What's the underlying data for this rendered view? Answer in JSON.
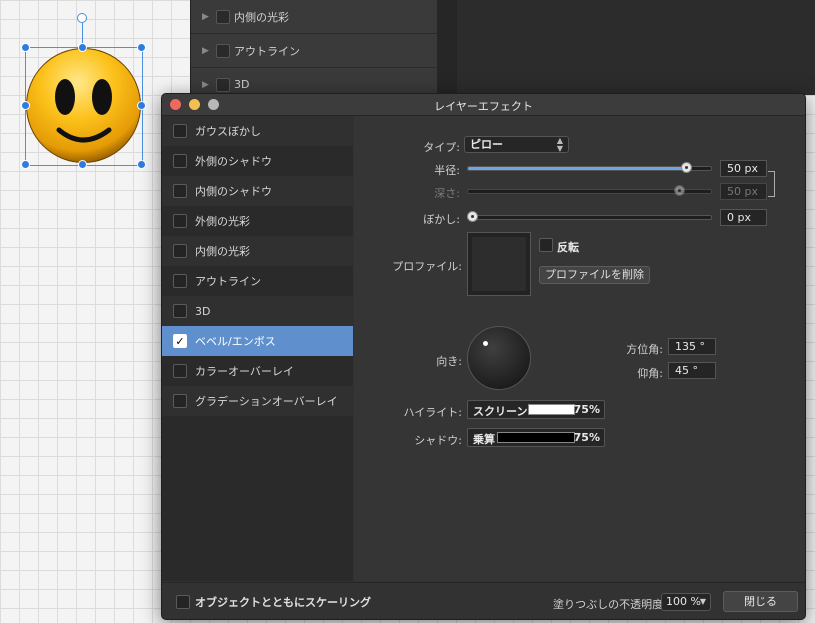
{
  "background_layers": [
    {
      "label": "内側の光彩"
    },
    {
      "label": "アウトライン"
    },
    {
      "label": "3D"
    }
  ],
  "dialog": {
    "title": "レイヤーエフェクト"
  },
  "effects": [
    {
      "label": "ガウスぼかし",
      "checked": false
    },
    {
      "label": "外側のシャドウ",
      "checked": false
    },
    {
      "label": "内側のシャドウ",
      "checked": false
    },
    {
      "label": "外側の光彩",
      "checked": false
    },
    {
      "label": "内側の光彩",
      "checked": false
    },
    {
      "label": "アウトライン",
      "checked": false
    },
    {
      "label": "3D",
      "checked": false
    },
    {
      "label": "ベベル/エンボス",
      "checked": true,
      "check_mark": "✓"
    },
    {
      "label": "カラーオーバーレイ",
      "checked": false
    },
    {
      "label": "グラデーションオーバーレイ",
      "checked": false
    }
  ],
  "settings": {
    "type_label": "タイプ:",
    "type_value": "ピロー",
    "radius_label": "半径:",
    "radius_value": "50 px",
    "radius_fraction": 0.9,
    "depth_label": "深さ:",
    "depth_value": "50 px",
    "blur_label": "ぼかし:",
    "blur_value": "0 px",
    "profile_label": "プロファイル:",
    "invert_label": "反転",
    "delete_profile_button": "プロファイルを削除",
    "direction_label": "向き:",
    "azimuth_label": "方位角:",
    "azimuth_value": "135 °",
    "elevation_label": "仰角:",
    "elevation_value": "45 °",
    "highlight_label": "ハイライト:",
    "highlight_mode": "スクリーン",
    "highlight_color": "#ffffff",
    "highlight_opacity": "75%",
    "shadow_label": "シャドウ:",
    "shadow_mode": "乗算",
    "shadow_color": "#000000",
    "shadow_opacity": "75%"
  },
  "footer": {
    "scale_with_object_label": "オブジェクトとともにスケーリング",
    "fill_opacity_label": "塗りつぶしの不透明度:",
    "fill_opacity_value": "100 %",
    "close_button": "閉じる"
  },
  "colors": {
    "selection_accent": "#5f8fcc",
    "slider_fill": "#6ea4e8"
  }
}
